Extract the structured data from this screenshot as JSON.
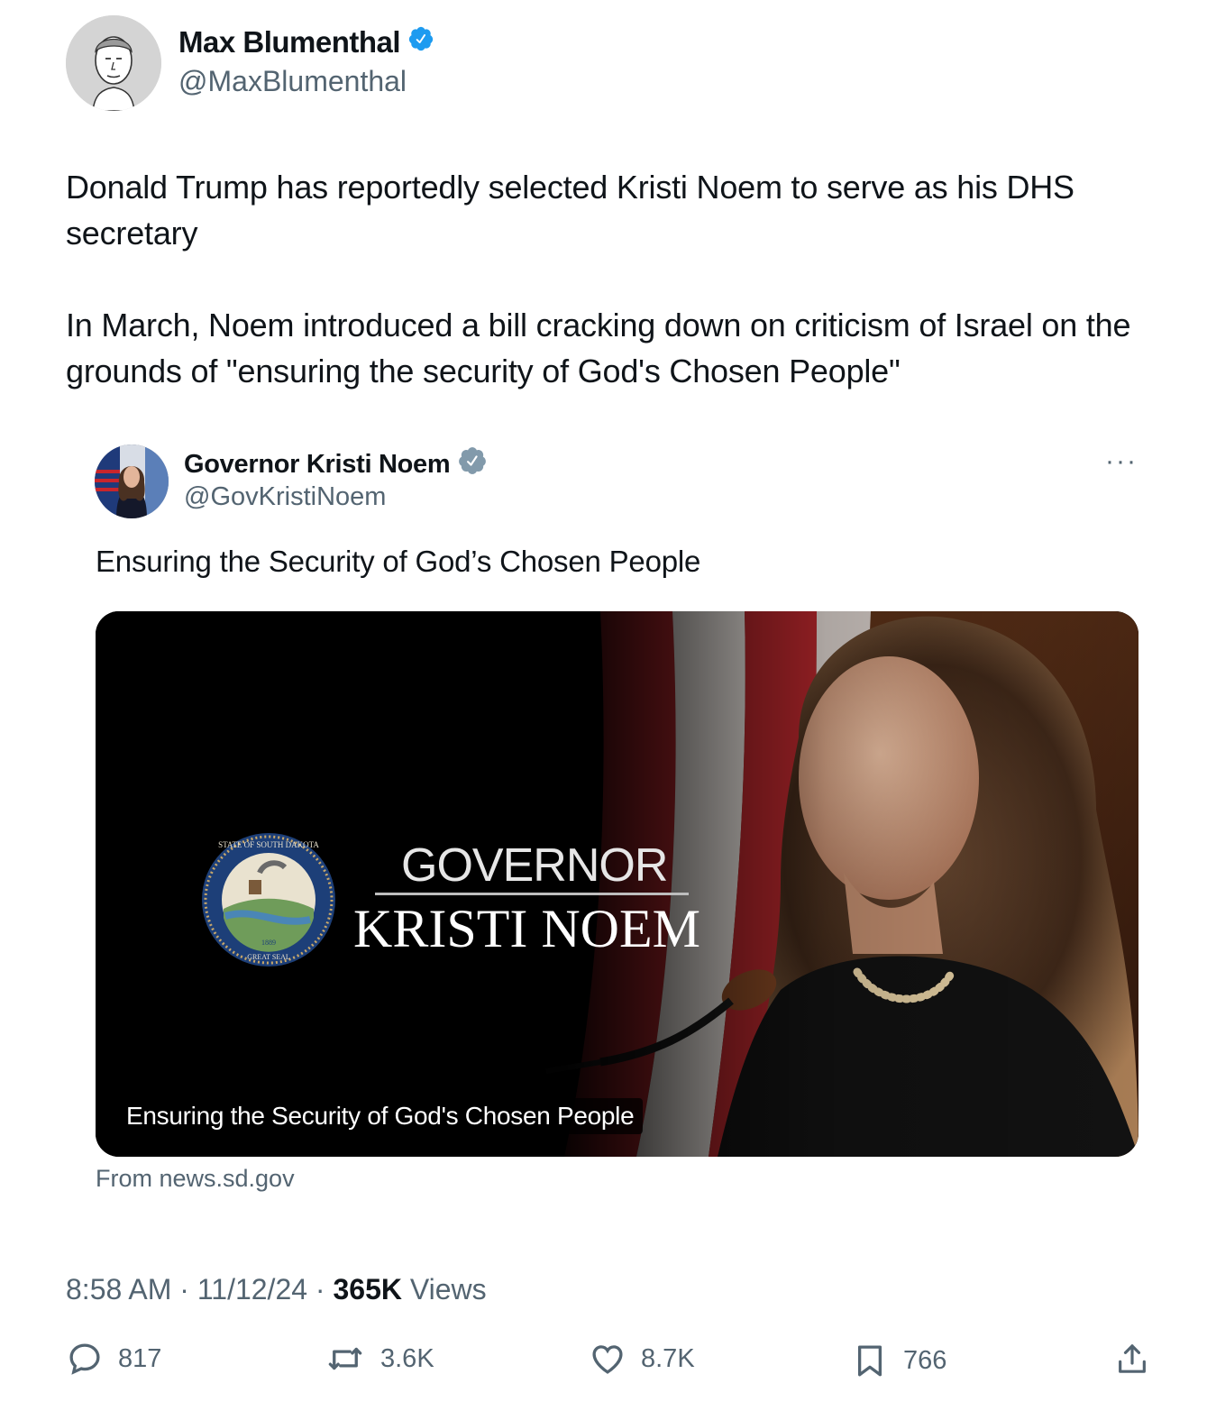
{
  "author": {
    "name": "Max Blumenthal",
    "handle": "@MaxBlumenthal",
    "verified_color": "#1d9bf0"
  },
  "tweet": {
    "text": "Donald Trump has reportedly selected Kristi Noem to serve as his DHS secretary\n\nIn March, Noem introduced a bill cracking down on criticism of Israel on the grounds of \"ensuring the security of God's Chosen People\""
  },
  "quote": {
    "name": "Governor Kristi Noem",
    "handle": "@GovKristiNoem",
    "verified_color": "#829aab",
    "more": "···",
    "text": "Ensuring the Security of God’s Chosen People",
    "media": {
      "title_top": "GOVERNOR",
      "title_name": "KRISTI NOEM",
      "seal_top": "STATE OF SOUTH DAKOTA",
      "seal_bottom": "GREAT SEAL",
      "seal_year": "1889",
      "caption": "Ensuring the Security of God's Chosen People"
    },
    "source": "From news.sd.gov"
  },
  "meta": {
    "time": "8:58 AM",
    "date": "11/12/24",
    "views_count": "365K",
    "views_label": "Views",
    "sep": "·"
  },
  "actions": {
    "replies": "817",
    "reposts": "3.6K",
    "likes": "8.7K",
    "bookmarks": "766"
  }
}
